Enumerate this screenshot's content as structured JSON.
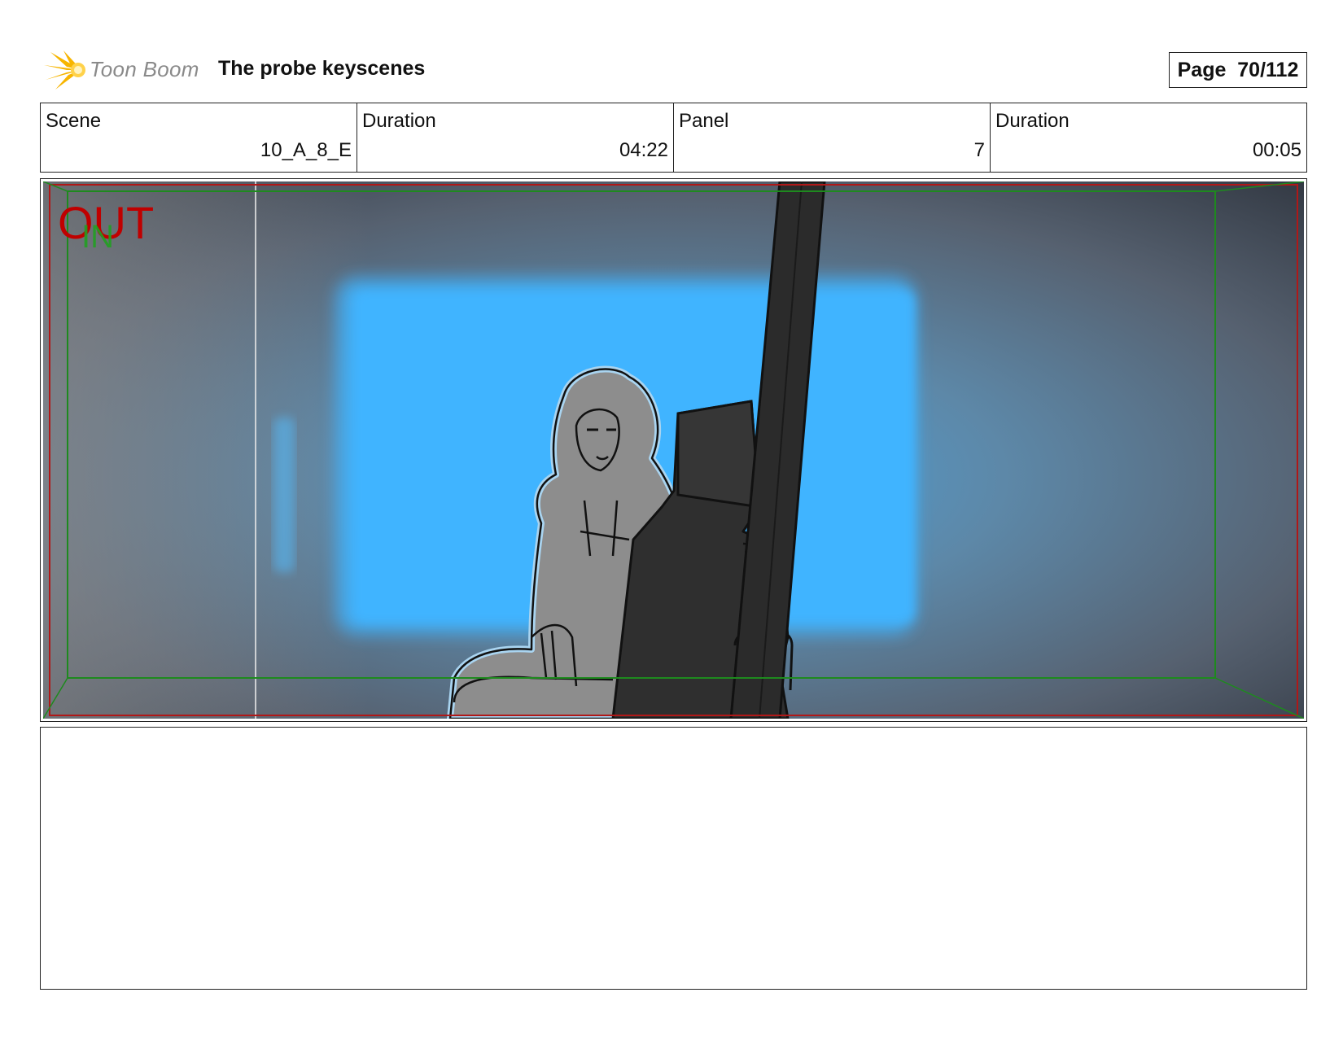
{
  "header": {
    "logo_text": "Toon Boom",
    "title": "The probe keyscenes",
    "page_label": "Page",
    "page_value": "70/112"
  },
  "info": {
    "scene_label": "Scene",
    "scene_value": "10_A_8_E",
    "scene_duration_label": "Duration",
    "scene_duration_value": "04:22",
    "panel_label": "Panel",
    "panel_value": "7",
    "panel_duration_label": "Duration",
    "panel_duration_value": "00:05"
  },
  "panel": {
    "overlay_out": "OUT",
    "overlay_in": "IN",
    "colors": {
      "out": "#c00000",
      "in": "#22a022",
      "window": "#3fb4ff",
      "machine": "#2f2f2f"
    }
  },
  "notes": {
    "text": ""
  }
}
